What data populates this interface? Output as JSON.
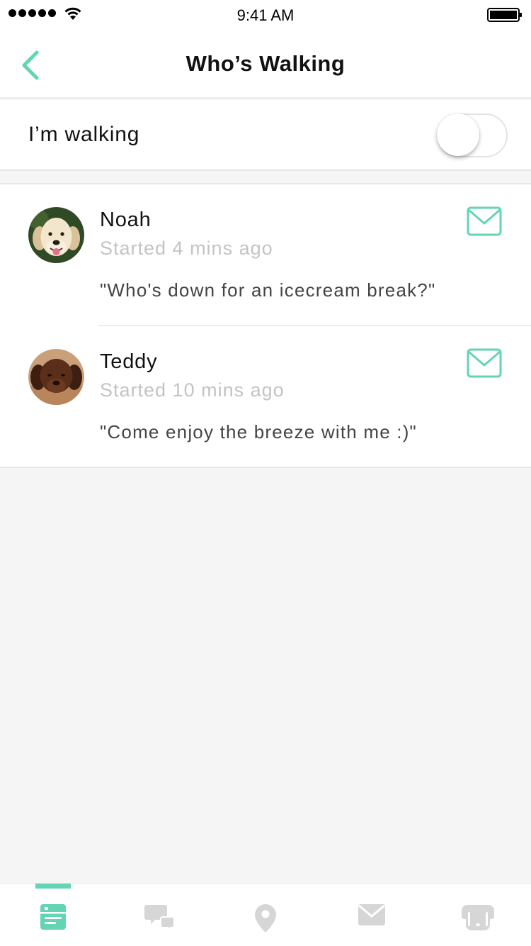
{
  "status_bar": {
    "time": "9:41 AM",
    "signal_dots": 5,
    "battery_level": 1.0
  },
  "nav": {
    "title": "Who’s Walking",
    "back_icon": "chevron-left-icon"
  },
  "walking_toggle": {
    "label": "I’m walking",
    "on": false
  },
  "walkers": [
    {
      "name": "Noah",
      "started": "Started 4 mins ago",
      "message": "\"Who's down for an icecream break?\"",
      "avatar": "golden-retriever-avatar",
      "action_icon": "mail-icon"
    },
    {
      "name": "Teddy",
      "started": "Started 10 mins ago",
      "message": "\"Come enjoy the breeze with me :)\"",
      "avatar": "chocolate-lab-puppy-avatar",
      "action_icon": "mail-icon"
    }
  ],
  "tabbar": {
    "active_index": 0,
    "tabs": [
      {
        "icon": "feed-card-icon",
        "active": true
      },
      {
        "icon": "chat-bubbles-icon",
        "active": false
      },
      {
        "icon": "location-pin-icon",
        "active": false
      },
      {
        "icon": "envelope-icon",
        "active": false
      },
      {
        "icon": "dog-face-icon",
        "active": false
      }
    ]
  },
  "colors": {
    "accent": "#63d4b4",
    "inactive_icon": "#d6d6d6",
    "background": "#f5f5f5",
    "muted_text": "#c4c4c4",
    "message_text": "#444444"
  }
}
